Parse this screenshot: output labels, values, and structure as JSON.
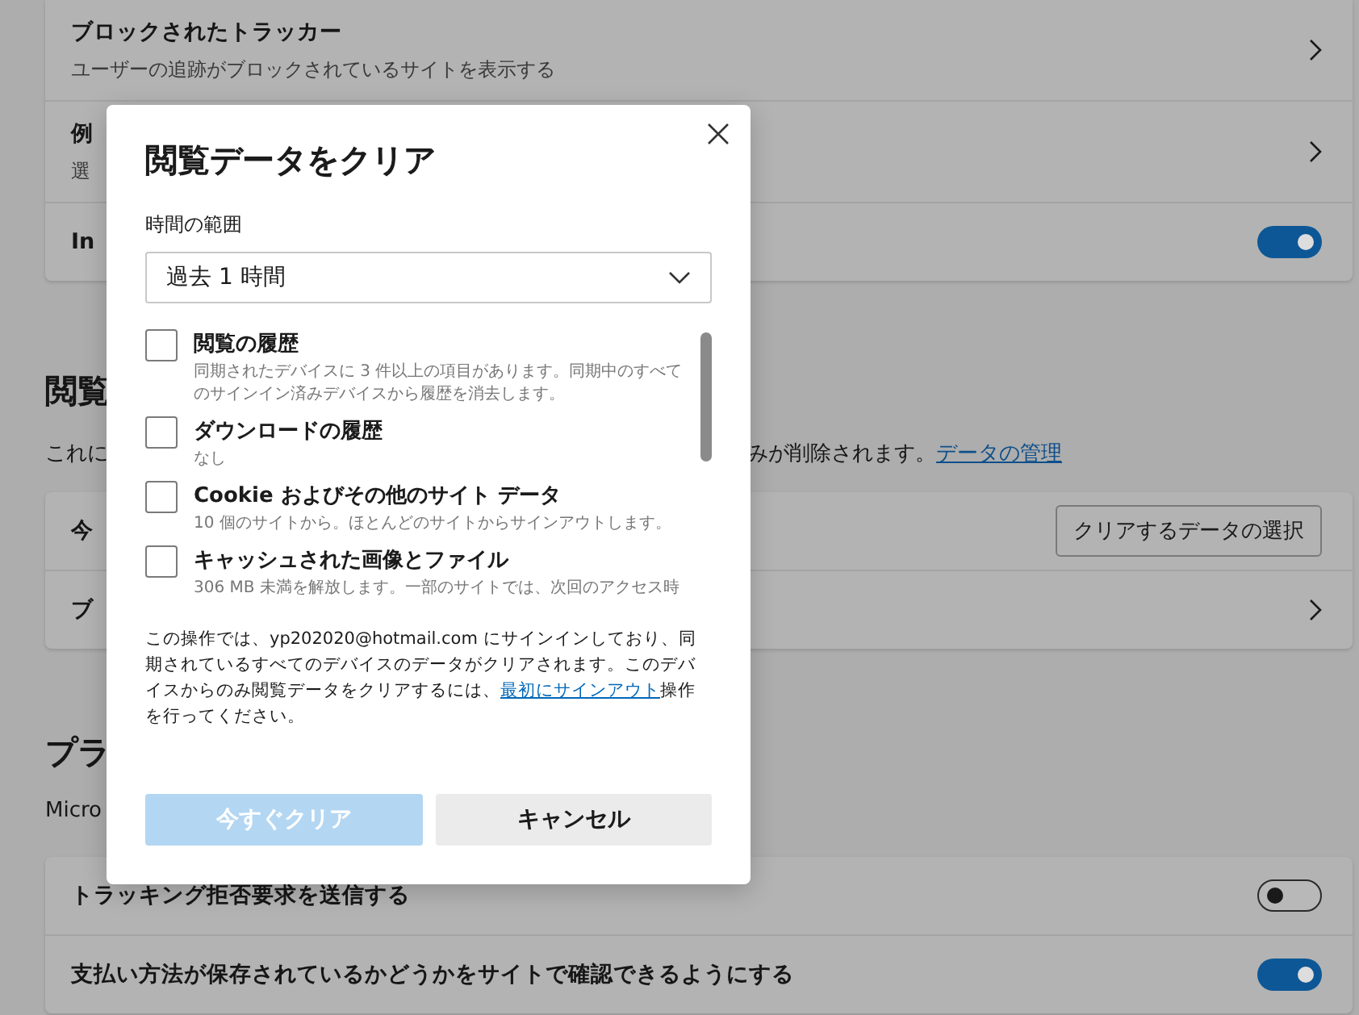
{
  "settings": {
    "card_top": {
      "rows": [
        {
          "kind": "link",
          "title": "ブロックされたトラッカー",
          "description": "ユーザーの追跡がブロックされているサイトを表示する"
        },
        {
          "kind": "link",
          "title": "例",
          "description": "選"
        },
        {
          "kind": "toggle",
          "title": "In",
          "on": true
        }
      ]
    },
    "browsing_section": {
      "heading": "閲覧",
      "description": "これに",
      "description_tail": "みが削除されます。",
      "link": "データの管理"
    },
    "card_browsing": {
      "rows": [
        {
          "kind": "button",
          "title": "今",
          "button": "クリアするデータの選択"
        },
        {
          "kind": "link",
          "title": "ブ"
        }
      ]
    },
    "privacy_section": {
      "heading": "プラ",
      "description": "Micro"
    },
    "card_privacy": {
      "rows": [
        {
          "kind": "toggle",
          "title": "トラッキング拒否要求を送信する",
          "on": false
        },
        {
          "kind": "toggle",
          "title": "支払い方法が保存されているかどうかをサイトで確認できるようにする",
          "on": true
        }
      ]
    }
  },
  "dialog": {
    "title": "閲覧データをクリア",
    "time_range_label": "時間の範囲",
    "time_range": "過去 1 時間",
    "items": [
      {
        "label": "閲覧の履歴",
        "description": "同期されたデバイスに 3 件以上の項目があります。同期中のすべてのサインイン済みデバイスから履歴を消去します。",
        "checked": false
      },
      {
        "label": "ダウンロードの履歴",
        "description": "なし",
        "checked": false
      },
      {
        "label": "Cookie およびその他のサイト データ",
        "description": "10 個のサイトから。ほとんどのサイトからサインアウトします。",
        "checked": false
      },
      {
        "label": "キャッシュされた画像とファイル",
        "description": "306 MB 未満を解放します。一部のサイトでは、次回のアクセス時",
        "checked": false
      }
    ],
    "notice": {
      "text": "この操作では、yp202020@hotmail.com にサインインしており、同期されているすべてのデバイスのデータがクリアされます。このデバイスからのみ閲覧データをクリアするには、",
      "link": "最初にサインアウト",
      "text_after": "操作を行ってください。"
    },
    "buttons": [
      {
        "kind": "primary",
        "label": "今すぐクリア",
        "disabled": true
      },
      {
        "kind": "secondary",
        "label": "キャンセル",
        "disabled": false
      }
    ]
  }
}
